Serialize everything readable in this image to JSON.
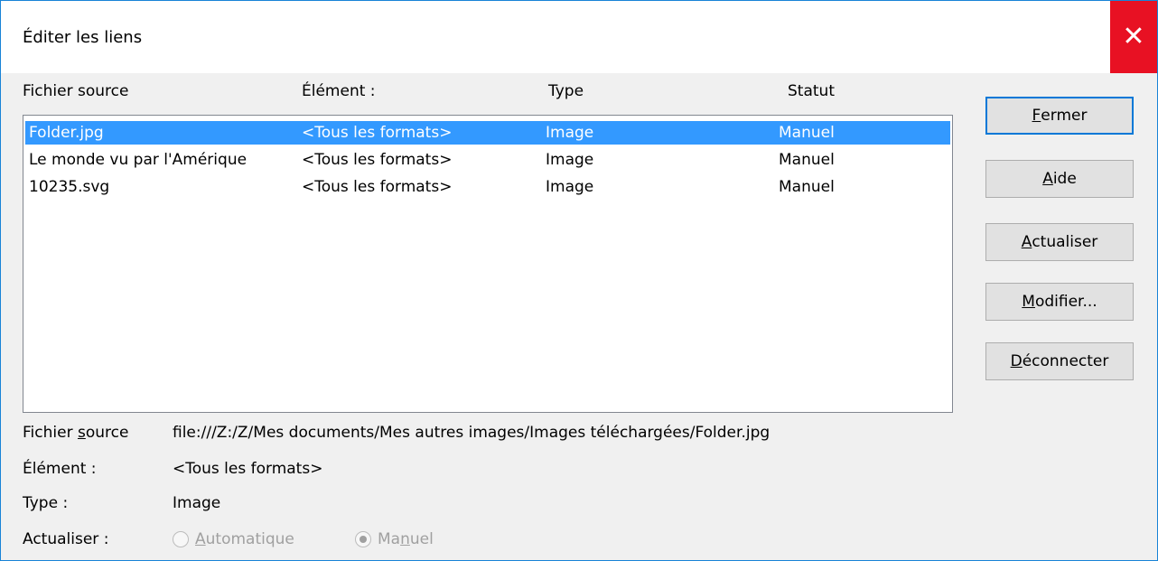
{
  "window": {
    "title": "Éditer les liens",
    "close_glyph": "✕"
  },
  "columns": {
    "source": "Fichier source",
    "element": "Élément :",
    "type": "Type",
    "status": "Statut"
  },
  "rows": [
    {
      "source": "Folder.jpg",
      "element": "<Tous les formats>",
      "type": "Image",
      "status": "Manuel"
    },
    {
      "source": "Le monde vu par l'Amérique",
      "element": "<Tous les formats>",
      "type": "Image",
      "status": "Manuel"
    },
    {
      "source": "10235.svg",
      "element": "<Tous les formats>",
      "type": "Image",
      "status": "Manuel"
    }
  ],
  "buttons": {
    "fermer": {
      "mnemonic": "F",
      "rest": "ermer"
    },
    "aide": {
      "mnemonic": "A",
      "rest": "ide"
    },
    "actualiser": {
      "mnemonic": "A",
      "rest": "ctualiser"
    },
    "modifier": {
      "mnemonic": "M",
      "rest": "odifier..."
    },
    "deconnecter": {
      "mnemonic": "D",
      "rest": "éconnecter"
    }
  },
  "details": {
    "source_label_pre": "Fichier ",
    "source_label_mnemonic": "s",
    "source_label_post": "ource",
    "source_value": "file:///Z:/Z/Mes documents/Mes autres images/Images téléchargées/Folder.jpg",
    "element_label": "Élément :",
    "element_value": "<Tous les formats>",
    "type_label": "Type :",
    "type_value": "Image",
    "update_label": "Actualiser :",
    "radio_auto_mnemonic": "A",
    "radio_auto_rest": "utomatique",
    "radio_manual_pre": "Ma",
    "radio_manual_mnemonic": "n",
    "radio_manual_post": "uel"
  },
  "colors": {
    "selection": "#3399ff",
    "close": "#e81123",
    "accent_border": "#0078d7"
  }
}
